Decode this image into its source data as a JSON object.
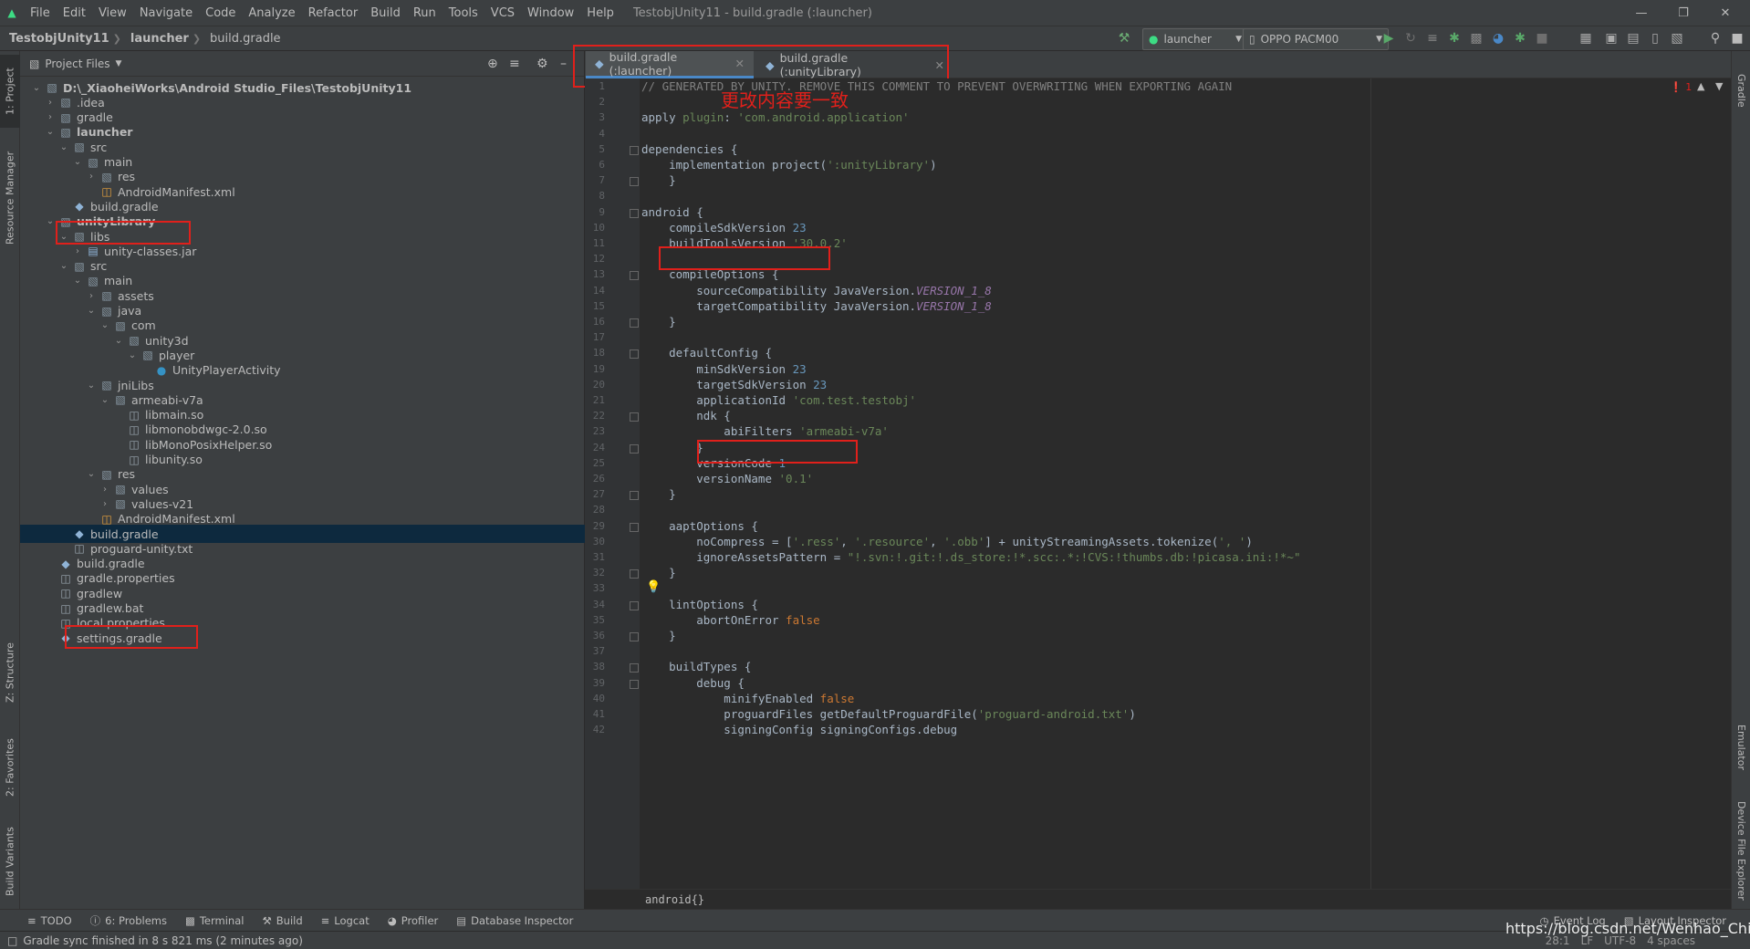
{
  "menubar": {
    "items": [
      "File",
      "Edit",
      "View",
      "Navigate",
      "Code",
      "Analyze",
      "Refactor",
      "Build",
      "Run",
      "Tools",
      "VCS",
      "Window",
      "Help"
    ],
    "window_title": "TestobjUnity11 - build.gradle (:launcher)"
  },
  "navbar": {
    "crumbs": [
      "TestobjUnity11",
      "launcher",
      "build.gradle"
    ],
    "run_config": "launcher",
    "device": "OPPO PACM00"
  },
  "left_strip": {
    "tabs": [
      "1: Project",
      "Resource Manager",
      "Z: Structure",
      "2: Favorites",
      "Build Variants"
    ]
  },
  "right_strip": {
    "tabs": [
      "Gradle",
      "Emulator",
      "Device File Explorer"
    ]
  },
  "project_panel": {
    "title": "Project Files",
    "tree": [
      {
        "label": "D:\\_XiaoheiWorks\\Android Studio_Files\\TestobjUnity11",
        "depth": 0,
        "arrow": "down",
        "icon": "folder",
        "bold": true
      },
      {
        "label": ".idea",
        "depth": 1,
        "arrow": "right",
        "icon": "folder"
      },
      {
        "label": "gradle",
        "depth": 1,
        "arrow": "right",
        "icon": "folder"
      },
      {
        "label": "launcher",
        "depth": 1,
        "arrow": "down",
        "icon": "folder",
        "bold": true
      },
      {
        "label": "src",
        "depth": 2,
        "arrow": "down",
        "icon": "folder"
      },
      {
        "label": "main",
        "depth": 3,
        "arrow": "down",
        "icon": "folder"
      },
      {
        "label": "res",
        "depth": 4,
        "arrow": "right",
        "icon": "folder"
      },
      {
        "label": "AndroidManifest.xml",
        "depth": 4,
        "arrow": "",
        "icon": "xml"
      },
      {
        "label": "build.gradle",
        "depth": 2,
        "arrow": "",
        "icon": "gradle"
      },
      {
        "label": "unityLibrary",
        "depth": 1,
        "arrow": "down",
        "icon": "folder",
        "bold": true
      },
      {
        "label": "libs",
        "depth": 2,
        "arrow": "down",
        "icon": "folder"
      },
      {
        "label": "unity-classes.jar",
        "depth": 3,
        "arrow": "right",
        "icon": "jar"
      },
      {
        "label": "src",
        "depth": 2,
        "arrow": "down",
        "icon": "folder"
      },
      {
        "label": "main",
        "depth": 3,
        "arrow": "down",
        "icon": "folder"
      },
      {
        "label": "assets",
        "depth": 4,
        "arrow": "right",
        "icon": "folder"
      },
      {
        "label": "java",
        "depth": 4,
        "arrow": "down",
        "icon": "folder"
      },
      {
        "label": "com",
        "depth": 5,
        "arrow": "down",
        "icon": "folder"
      },
      {
        "label": "unity3d",
        "depth": 6,
        "arrow": "down",
        "icon": "folder"
      },
      {
        "label": "player",
        "depth": 7,
        "arrow": "down",
        "icon": "folder"
      },
      {
        "label": "UnityPlayerActivity",
        "depth": 8,
        "arrow": "",
        "icon": "class"
      },
      {
        "label": "jniLibs",
        "depth": 4,
        "arrow": "down",
        "icon": "folder"
      },
      {
        "label": "armeabi-v7a",
        "depth": 5,
        "arrow": "down",
        "icon": "folder"
      },
      {
        "label": "libmain.so",
        "depth": 6,
        "arrow": "",
        "icon": "file"
      },
      {
        "label": "libmonobdwgc-2.0.so",
        "depth": 6,
        "arrow": "",
        "icon": "file"
      },
      {
        "label": "libMonoPosixHelper.so",
        "depth": 6,
        "arrow": "",
        "icon": "file"
      },
      {
        "label": "libunity.so",
        "depth": 6,
        "arrow": "",
        "icon": "file"
      },
      {
        "label": "res",
        "depth": 4,
        "arrow": "down",
        "icon": "folder"
      },
      {
        "label": "values",
        "depth": 5,
        "arrow": "right",
        "icon": "folder"
      },
      {
        "label": "values-v21",
        "depth": 5,
        "arrow": "right",
        "icon": "folder"
      },
      {
        "label": "AndroidManifest.xml",
        "depth": 4,
        "arrow": "",
        "icon": "xml"
      },
      {
        "label": "build.gradle",
        "depth": 2,
        "arrow": "",
        "icon": "gradle",
        "selected": true
      },
      {
        "label": "proguard-unity.txt",
        "depth": 2,
        "arrow": "",
        "icon": "txt"
      },
      {
        "label": "build.gradle",
        "depth": 1,
        "arrow": "",
        "icon": "gradle"
      },
      {
        "label": "gradle.properties",
        "depth": 1,
        "arrow": "",
        "icon": "file"
      },
      {
        "label": "gradlew",
        "depth": 1,
        "arrow": "",
        "icon": "file"
      },
      {
        "label": "gradlew.bat",
        "depth": 1,
        "arrow": "",
        "icon": "file"
      },
      {
        "label": "local.properties",
        "depth": 1,
        "arrow": "",
        "icon": "file"
      },
      {
        "label": "settings.gradle",
        "depth": 1,
        "arrow": "",
        "icon": "gradle"
      }
    ]
  },
  "editor": {
    "tabs": [
      "build.gradle (:launcher)",
      "build.gradle (:unityLibrary)"
    ],
    "annotation": "更改内容要一致",
    "error_count": "1",
    "breadcrumb": "android{}",
    "lines": [
      [
        [
          "cmt",
          "// GENERATED BY UNITY. REMOVE THIS COMMENT TO PREVENT OVERWRITING WHEN EXPORTING AGAIN"
        ]
      ],
      [],
      [
        [
          "",
          "apply "
        ],
        [
          "plg",
          "plugin"
        ],
        [
          "",
          ": "
        ],
        [
          "str",
          "'com.android.application'"
        ]
      ],
      [],
      [
        [
          "",
          "dependencies {"
        ]
      ],
      [
        [
          "",
          "    implementation project("
        ],
        [
          "str",
          "':unityLibrary'"
        ],
        [
          "",
          ")"
        ]
      ],
      [
        [
          "",
          "    }"
        ]
      ],
      [],
      [
        [
          "",
          "android {"
        ]
      ],
      [
        [
          "",
          "    compileSdkVersion "
        ],
        [
          "num",
          "23"
        ]
      ],
      [
        [
          "",
          "    buildToolsVersion "
        ],
        [
          "str",
          "'30.0.2'"
        ]
      ],
      [],
      [
        [
          "",
          "    compileOptions {"
        ]
      ],
      [
        [
          "",
          "        sourceCompatibility JavaVersion."
        ],
        [
          "it",
          "VERSION_1_8"
        ]
      ],
      [
        [
          "",
          "        targetCompatibility JavaVersion."
        ],
        [
          "it",
          "VERSION_1_8"
        ]
      ],
      [
        [
          "",
          "    }"
        ]
      ],
      [],
      [
        [
          "",
          "    defaultConfig {"
        ]
      ],
      [
        [
          "",
          "        minSdkVersion "
        ],
        [
          "num",
          "23"
        ]
      ],
      [
        [
          "",
          "        targetSdkVersion "
        ],
        [
          "num",
          "23"
        ]
      ],
      [
        [
          "",
          "        applicationId "
        ],
        [
          "str",
          "'com.test.testobj'"
        ]
      ],
      [
        [
          "",
          "        ndk {"
        ]
      ],
      [
        [
          "",
          "            abiFilters "
        ],
        [
          "str",
          "'armeabi-v7a'"
        ]
      ],
      [
        [
          "",
          "        }"
        ]
      ],
      [
        [
          "",
          "        versionCode "
        ],
        [
          "num",
          "1"
        ]
      ],
      [
        [
          "",
          "        versionName "
        ],
        [
          "str",
          "'0.1'"
        ]
      ],
      [
        [
          "",
          "    }"
        ]
      ],
      [],
      [
        [
          "",
          "    aaptOptions {"
        ]
      ],
      [
        [
          "",
          "        noCompress = ["
        ],
        [
          "str",
          "'.ress'"
        ],
        [
          "",
          ", "
        ],
        [
          "str",
          "'.resource'"
        ],
        [
          "",
          ", "
        ],
        [
          "str",
          "'.obb'"
        ],
        [
          "",
          "] + unityStreamingAssets.tokenize("
        ],
        [
          "str",
          "', '"
        ],
        [
          "",
          ")"
        ]
      ],
      [
        [
          "",
          "        ignoreAssetsPattern = "
        ],
        [
          "str",
          "\"!.svn:!.git:!.ds_store:!*.scc:.*:!CVS:!thumbs.db:!picasa.ini:!*~\""
        ]
      ],
      [
        [
          "",
          "    }"
        ]
      ],
      [],
      [
        [
          "",
          "    lintOptions {"
        ]
      ],
      [
        [
          "",
          "        abortOnError "
        ],
        [
          "kw",
          "false"
        ]
      ],
      [
        [
          "",
          "    }"
        ]
      ],
      [],
      [
        [
          "",
          "    buildTypes {"
        ]
      ],
      [
        [
          "",
          "        debug {"
        ]
      ],
      [
        [
          "",
          "            minifyEnabled "
        ],
        [
          "kw",
          "false"
        ]
      ],
      [
        [
          "",
          "            proguardFiles getDefaultProguardFile("
        ],
        [
          "str",
          "'proguard-android.txt'"
        ],
        [
          "",
          ")"
        ]
      ],
      [
        [
          "",
          "            signingConfig signingConfigs.debug"
        ]
      ]
    ]
  },
  "toolwindows": [
    "TODO",
    "6: Problems",
    "Terminal",
    "Build",
    "Logcat",
    "Profiler",
    "Database Inspector"
  ],
  "toolwindows_right": [
    "Event Log",
    "Layout Inspector"
  ],
  "status": {
    "message": "Gradle sync finished in 8 s 821 ms (2 minutes ago)",
    "right": [
      "28:1",
      "LF",
      "UTF-8",
      "4 spaces"
    ]
  },
  "watermark": "https://blog.csdn.net/Wenhao_China"
}
